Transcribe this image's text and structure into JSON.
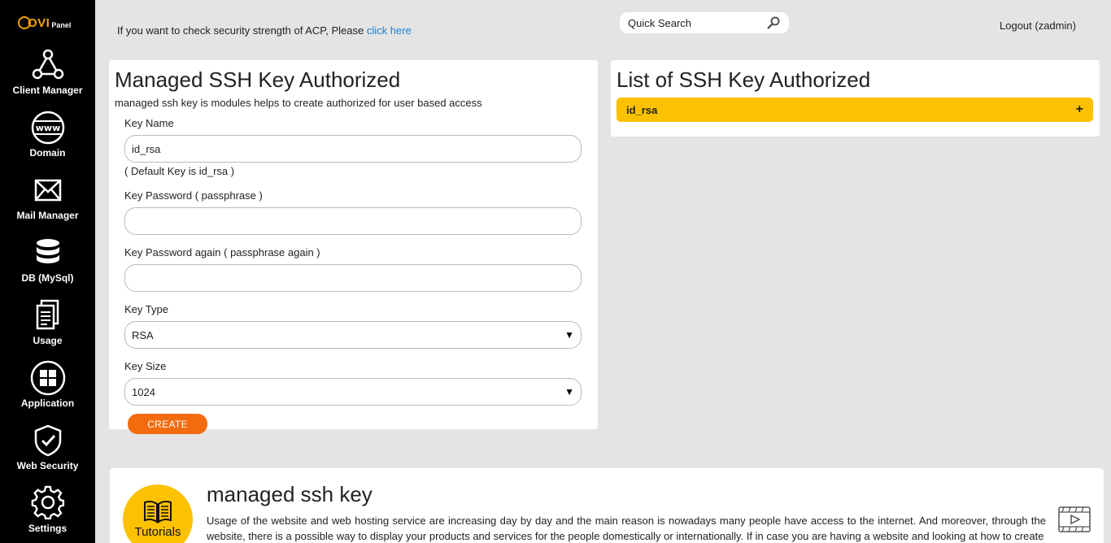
{
  "brand": {
    "name": "OVI",
    "sub": "Panel"
  },
  "sidebar": {
    "items": [
      {
        "label": "Client Manager",
        "icon": "client-manager-icon"
      },
      {
        "label": "Domain",
        "icon": "www-globe-icon"
      },
      {
        "label": "Mail Manager",
        "icon": "envelope-icon"
      },
      {
        "label": "DB (MySql)",
        "icon": "database-icon"
      },
      {
        "label": "Usage",
        "icon": "documents-icon"
      },
      {
        "label": "Application",
        "icon": "app-grid-icon"
      },
      {
        "label": "Web Security",
        "icon": "shield-check-icon"
      },
      {
        "label": "Settings",
        "icon": "gear-icon"
      }
    ]
  },
  "header": {
    "security_msg": "If you want to check security strength of ACP, Please ",
    "security_link": "click here",
    "search_placeholder": "Quick Search",
    "logout": "Logout (zadmin)"
  },
  "form_panel": {
    "title": "Managed SSH Key Authorized",
    "description": "managed ssh key is modules helps to create authorized for user based access",
    "key_name_label": "Key Name",
    "key_name_value": "id_rsa",
    "key_name_hint": "( Default Key is id_rsa )",
    "password_label": "Key Password ( passphrase )",
    "password_again_label": "Key Password again ( passphrase again )",
    "key_type_label": "Key Type",
    "key_type_value": "RSA",
    "key_size_label": "Key Size",
    "key_size_value": "1024",
    "create_label": "CREATE"
  },
  "list_panel": {
    "title": "List of SSH Key Authorized",
    "keys": [
      {
        "name": "id_rsa",
        "toggle": "+"
      }
    ]
  },
  "tutorial": {
    "badge": "Tutorials",
    "title": "managed ssh key",
    "text": "Usage of the website and web hosting service are increasing day by day and the main reason is nowadays many people have access to the internet. And moreover, through the website, there is a possible way to display your products and services for the people domestically or internationally. If in case you are having a website and looking at how to create"
  },
  "colors": {
    "accent": "#fcc101",
    "button": "#f26b0f",
    "link": "#1a7fd6",
    "sidebar": "#000000"
  }
}
